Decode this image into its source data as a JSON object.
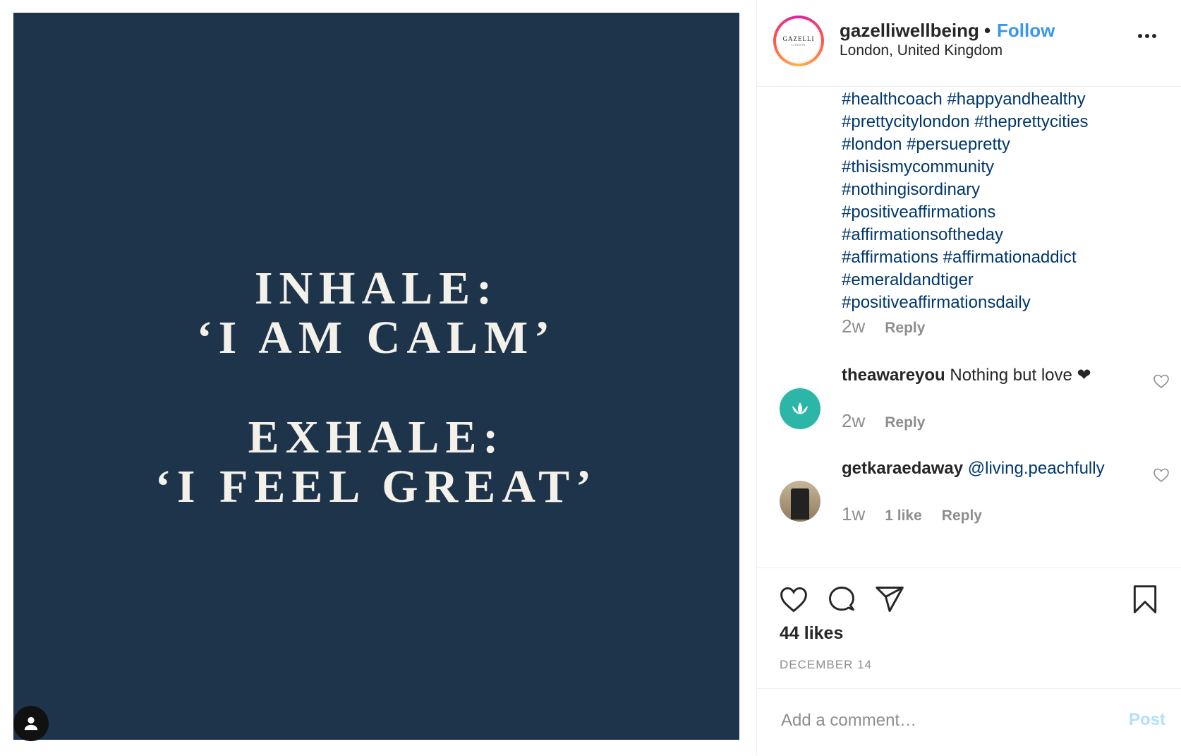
{
  "post": {
    "image_lines": [
      "INHALE:",
      "‘I AM CALM’",
      "EXHALE:",
      "‘I FEEL GREAT’"
    ],
    "image_background": "#1d344b"
  },
  "header": {
    "username": "gazelliwellbeing",
    "separator": "•",
    "follow_label": "Follow",
    "location": "London, United Kingdom",
    "avatar_text": "GAZELLI",
    "avatar_subtext": "LONDON"
  },
  "caption": {
    "hashtag_lines": [
      "#healthcoach #happyandhealthy",
      "#prettycitylondon #theprettycities",
      "#london #persuepretty",
      "#thisismycommunity",
      "#nothingisordinary",
      "#positiveaffirmations",
      "#affirmationsoftheday",
      "#affirmations #affirmationaddict",
      "#emeraldandtiger",
      "#positiveaffirmationsdaily"
    ],
    "time": "2w",
    "reply_label": "Reply"
  },
  "comments": [
    {
      "username": "theawareyou",
      "text": "Nothing but love ❤",
      "time": "2w",
      "reply_label": "Reply"
    },
    {
      "username": "getkaraedaway",
      "mention": "@living.peachfully",
      "time": "1w",
      "likes": "1 like",
      "reply_label": "Reply"
    }
  ],
  "actions": {
    "likes": "44 likes",
    "date": "DECEMBER 14"
  },
  "add_comment": {
    "placeholder": "Add a comment…",
    "post_label": "Post"
  },
  "icons": [
    "user-tag-icon",
    "more-options-icon",
    "lotus-icon",
    "heart-icon",
    "comment-icon",
    "share-icon",
    "bookmark-icon"
  ],
  "colors": {
    "accent": "#3897f0",
    "hashtag": "#00376b",
    "muted": "#8e8e8e",
    "post_disabled": "#b2dffc"
  }
}
